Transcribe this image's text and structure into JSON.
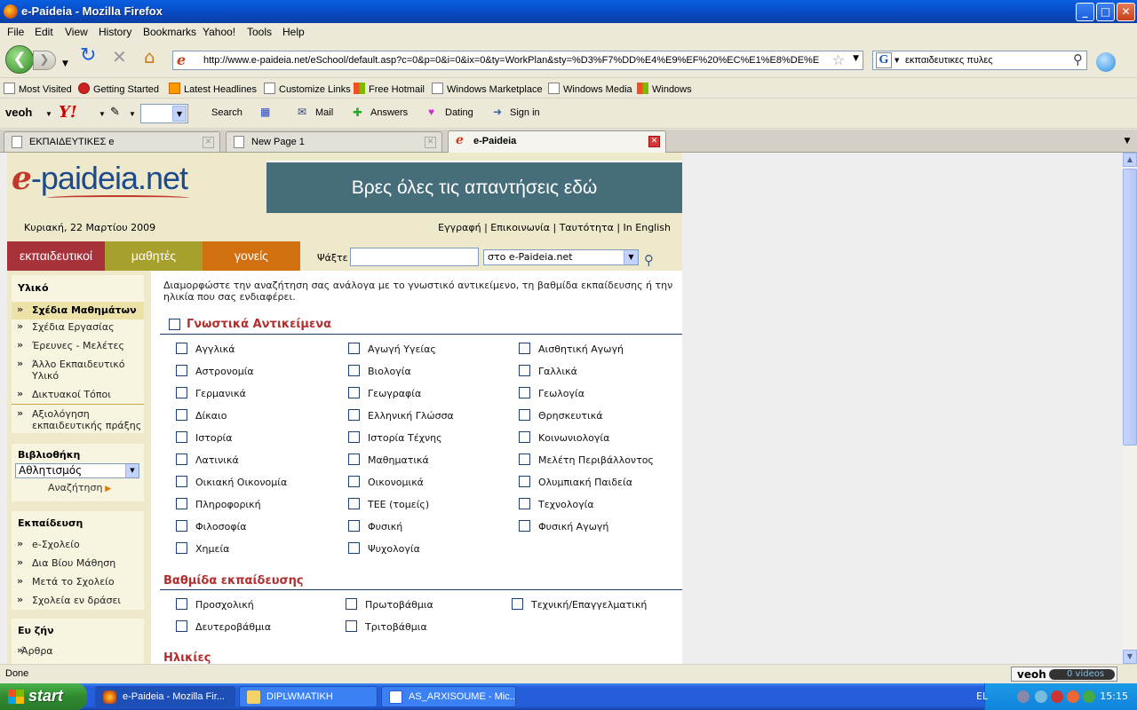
{
  "window": {
    "title": "e-Paideia - Mozilla Firefox",
    "buttons": {
      "minimize": "_",
      "maximize": "□",
      "close": "✕"
    }
  },
  "menu": [
    "File",
    "Edit",
    "View",
    "History",
    "Bookmarks",
    "Yahoo!",
    "Tools",
    "Help"
  ],
  "nav": {
    "url": "http://www.e-paideia.net/eSchool/default.asp?c=0&p=0&i=0&ix=0&ty=WorkPlan&sty=%D3%F7%DD%E4%E9%EF%20%EC%E1%E8%DE%E",
    "search_value": "εκπαιδευτικες πυλες"
  },
  "bookmarks": [
    "Most Visited",
    "Getting Started",
    "Latest Headlines",
    "Customize Links",
    "Free Hotmail",
    "Windows Marketplace",
    "Windows Media",
    "Windows"
  ],
  "yahoo_toolbar": {
    "veoh": "veoh",
    "yahoo": "Y!",
    "search": "Search",
    "mail": "Mail",
    "answers": "Answers",
    "dating": "Dating",
    "signin": "Sign in"
  },
  "tabs": [
    {
      "label": "ΕΚΠΑΙΔΕΥΤΙΚΕΣ e",
      "active": false
    },
    {
      "label": "New Page 1",
      "active": false
    },
    {
      "label": "e-Paideia",
      "active": true
    }
  ],
  "site": {
    "logo_e": "e",
    "logo_rest": "-paideia.net",
    "banner": "Βρες όλες τις απαντήσεις εδώ",
    "date": "Κυριακή, 22 Μαρτίου 2009",
    "toplinks": "Εγγραφή | Επικοινωνία | Ταυτότητα | In English",
    "main_tabs": [
      {
        "label": "εκπαιδευτικοί",
        "color": "#a8323a"
      },
      {
        "label": "μαθητές",
        "color": "#a8a02d"
      },
      {
        "label": "γονείς",
        "color": "#d2700f"
      }
    ],
    "search_label": "Ψάξτε",
    "search_value": "",
    "scope": "στο e-Paideia.net"
  },
  "sidebar": {
    "material": {
      "title": "Υλικό",
      "items": [
        {
          "label": "Σχέδια Μαθημάτων",
          "active": true
        },
        {
          "label": "Σχέδια Εργασίας",
          "active": false
        },
        {
          "label": "Έρευνες - Μελέτες",
          "active": false
        },
        {
          "label": "Άλλο Εκπαιδευτικό Υλικό",
          "active": false
        },
        {
          "label": "Δικτυακοί Τόποι",
          "active": false
        },
        {
          "label": "Αξιολόγηση εκπαιδευτικής πράξης",
          "active": false
        }
      ]
    },
    "library": {
      "title": "Βιβλιοθήκη",
      "selected": "Αθλητισμός",
      "go": "Αναζήτηση"
    },
    "education": {
      "title": "Εκπαίδευση",
      "items": [
        "e-Σχολείο",
        "Δια Βίου Μάθηση",
        "Μετά το Σχολείο",
        "Σχολεία εν δράσει"
      ]
    },
    "wellbeing": {
      "title": "Ευ ζήν",
      "items": [
        "Άρθρα"
      ]
    }
  },
  "main": {
    "intro": "Διαμορφώστε την αναζήτηση σας ανάλογα με το γνωστικό αντικείμενο, τη βαθμίδα εκπαίδευσης ή την ηλικία που σας ενδιαφέρει.",
    "subjects_title": "Γνωστικά Αντικείμενα",
    "subjects": [
      "Αγγλικά",
      "Αγωγή Υγείας",
      "Αισθητική Αγωγή",
      "Αστρονομία",
      "Βιολογία",
      "Γαλλικά",
      "Γερμανικά",
      "Γεωγραφία",
      "Γεωλογία",
      "Δίκαιο",
      "Ελληνική Γλώσσα",
      "Θρησκευτικά",
      "Ιστορία",
      "Ιστορία Τέχνης",
      "Κοινωνιολογία",
      "Λατινικά",
      "Μαθηματικά",
      "Μελέτη Περιβάλλοντος",
      "Οικιακή Οικονομία",
      "Οικονομικά",
      "Ολυμπιακή Παιδεία",
      "Πληροφορική",
      "ΤΕΕ (τομείς)",
      "Τεχνολογία",
      "Φιλοσοφία",
      "Φυσική",
      "Φυσική Αγωγή",
      "Χημεία",
      "Ψυχολογία"
    ],
    "levels_title": "Βαθμίδα εκπαίδευσης",
    "levels": [
      "Προσχολική",
      "Πρωτοβάθμια",
      "Τεχνική/Επαγγελματική",
      "Δευτεροβάθμια",
      "Τριτοβάθμια"
    ],
    "ages_title": "Ηλικίες"
  },
  "status": {
    "text": "Done",
    "veoh": "veoh",
    "videos": "0  videos"
  },
  "taskbar": {
    "start": "start",
    "tasks": [
      "e-Paideia - Mozilla Fir...",
      "DIPLWMATIKH",
      "AS_ARXISOUME - Mic..."
    ],
    "lang": "EL",
    "clock": "15:15"
  }
}
